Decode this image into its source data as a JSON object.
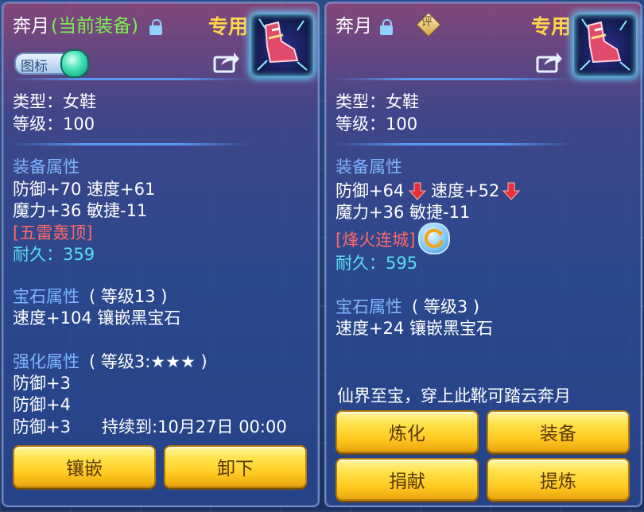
{
  "left": {
    "name": "奔月",
    "status": "(当前装备)",
    "special_tag": "专用",
    "icon_toggle_label": "图标",
    "type_line": "类型：女鞋",
    "level_line": "等级：100",
    "equip_header": "装备属性",
    "stats_line1": "防御+70 速度+61",
    "stats_line2": "魔力+36 敏捷-11",
    "skill": "[五雷轰顶]",
    "durability": "耐久：359",
    "gem_header": "宝石属性",
    "gem_level": "( 等级13 )",
    "gem_detail": "速度+104 镶嵌黑宝石",
    "strengthen_header": "强化属性",
    "strengthen_level": "( 等级3:★★★ )",
    "strengthen_lines": [
      "防御+3",
      "防御+4",
      "防御+3"
    ],
    "duration": "持续到:10月27日 00:00",
    "buttons": {
      "inlay": "镶嵌",
      "unequip": "卸下"
    }
  },
  "right": {
    "name": "奔月",
    "rate_badge": "评",
    "special_tag": "专用",
    "type_line": "类型：女鞋",
    "level_line": "等级：100",
    "equip_header": "装备属性",
    "def_stat": "防御+64",
    "spd_stat": "速度+52",
    "stats_line2": "魔力+36 敏捷-11",
    "skill": "[烽火连城]",
    "durability": "耐久：595",
    "gem_header": "宝石属性",
    "gem_level": "( 等级3 )",
    "gem_detail": "速度+24 镶嵌黑宝石",
    "description": "仙界至宝，穿上此靴可踏云奔月",
    "buttons": {
      "refine": "炼化",
      "equip": "装备",
      "donate": "捐献",
      "extract": "提炼"
    }
  },
  "icons": [
    "lock-icon",
    "share-icon",
    "toggle-switch",
    "down-arrow-icon",
    "refresh-icon",
    "rating-badge-icon"
  ],
  "colors": {
    "gold": "#ffd54a",
    "green": "#7df04e",
    "blue": "#7fb6ff",
    "red": "#ff6868",
    "cyan": "#57e0f2",
    "panel_border": "#6f86c6"
  }
}
